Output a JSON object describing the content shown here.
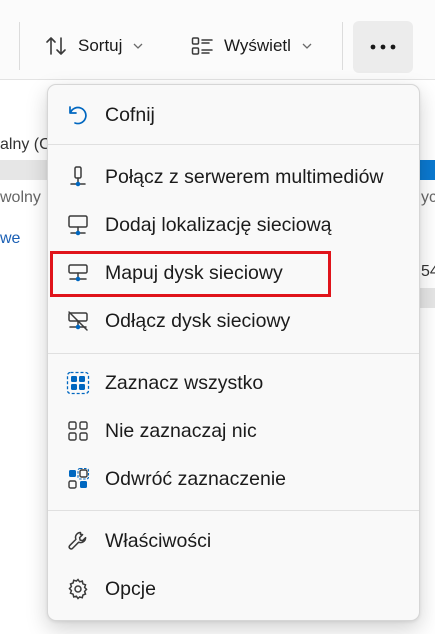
{
  "toolbar": {
    "sort_label": "Sortuj",
    "view_label": "Wyświetl",
    "more_label": "···"
  },
  "background": {
    "col_text_1": "alny (C",
    "col_text_2": "wolny",
    "col_text_3": "ych",
    "link_text": "we",
    "num_text": "54"
  },
  "menu": {
    "groups": [
      [
        {
          "label": "Cofnij",
          "icon": "undo-icon"
        }
      ],
      [
        {
          "label": "Połącz z serwerem multimediów",
          "icon": "media-server-icon"
        },
        {
          "label": "Dodaj lokalizację sieciową",
          "icon": "network-location-icon"
        },
        {
          "label": "Mapuj dysk sieciowy",
          "icon": "map-drive-icon",
          "highlighted": true
        },
        {
          "label": "Odłącz dysk sieciowy",
          "icon": "disconnect-drive-icon"
        }
      ],
      [
        {
          "label": "Zaznacz wszystko",
          "icon": "select-all-icon"
        },
        {
          "label": "Nie zaznaczaj nic",
          "icon": "select-none-icon"
        },
        {
          "label": "Odwróć zaznaczenie",
          "icon": "invert-selection-icon"
        }
      ],
      [
        {
          "label": "Właściwości",
          "icon": "wrench-icon"
        },
        {
          "label": "Opcje",
          "icon": "gear-icon"
        }
      ]
    ]
  },
  "colors": {
    "accent": "#0067c0",
    "highlight_border": "#e0141b"
  }
}
